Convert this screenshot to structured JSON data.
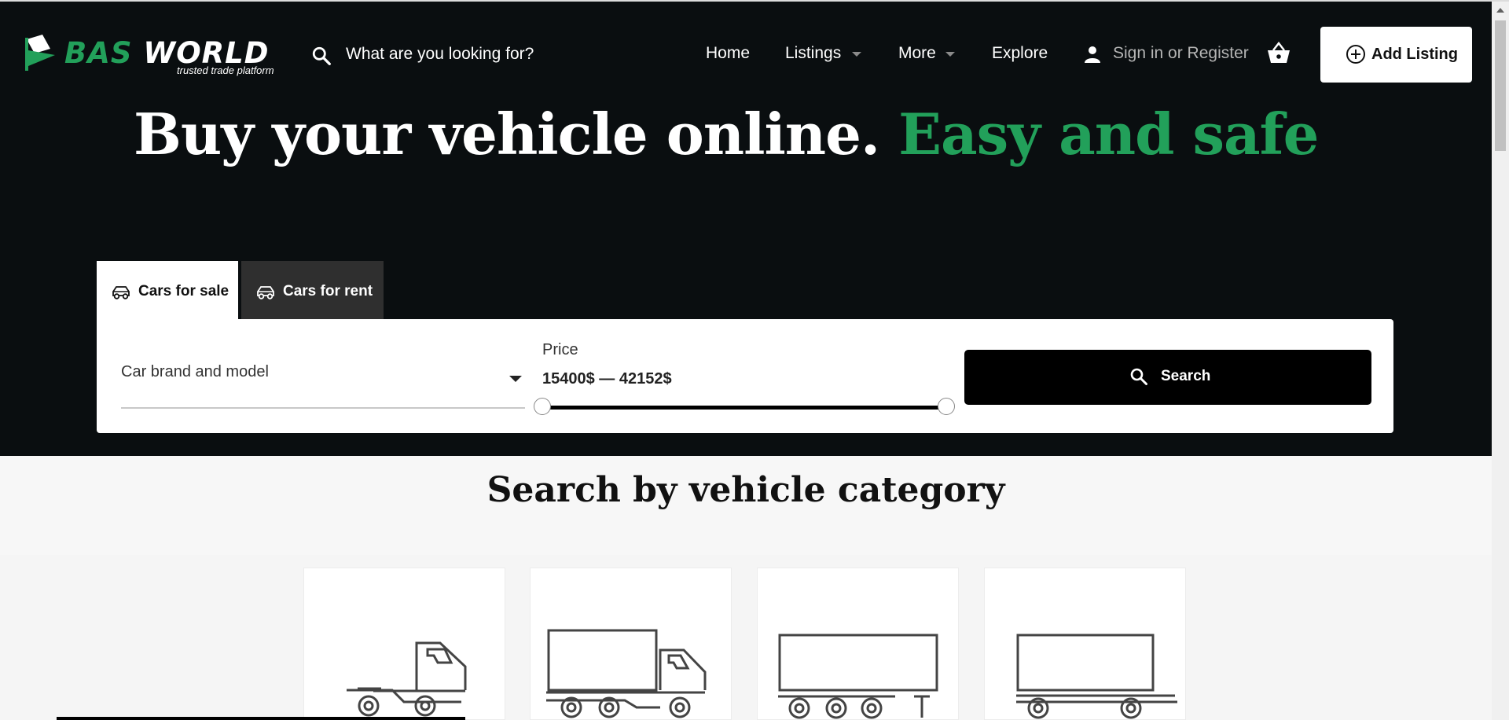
{
  "brand": {
    "name_part1": "BAS",
    "name_part2": "WORLD",
    "tagline": "trusted trade platform"
  },
  "header": {
    "search_placeholder": "What are you looking for?",
    "nav": {
      "home": "Home",
      "listings": "Listings",
      "more": "More",
      "explore": "Explore"
    },
    "signin": "Sign in or Register",
    "add_listing": "Add Listing"
  },
  "hero": {
    "headline_white": "Buy your vehicle online.",
    "headline_green": "Easy and safe"
  },
  "tabs": [
    {
      "label": "Cars for sale",
      "icon": "car-icon"
    },
    {
      "label": "Cars for rent",
      "icon": "car-icon"
    }
  ],
  "search_form": {
    "brand_model_placeholder": "Car brand and model",
    "price_label": "Price",
    "price_range": "15400$ — 42152$",
    "price_min_fraction": 0.0,
    "price_max_fraction": 1.0,
    "search_button": "Search"
  },
  "categories": {
    "title": "Search by vehicle category",
    "items": [
      {
        "icon": "tractor-unit-icon"
      },
      {
        "icon": "box-truck-icon"
      },
      {
        "icon": "semi-trailer-icon"
      },
      {
        "icon": "trailer-icon"
      }
    ]
  },
  "colors": {
    "accent_green": "#22a05a",
    "hero_bg": "#0a0e10"
  }
}
